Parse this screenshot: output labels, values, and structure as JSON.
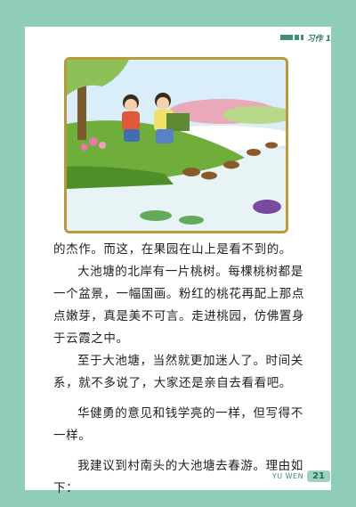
{
  "header": {
    "title": "习作 1"
  },
  "illustration": {
    "subject": "two-children-by-pond"
  },
  "text": {
    "p1": "的杰作。而这，在果园在山上是看不到的。",
    "p2": "大池塘的北岸有一片桃树。每棵桃树都是一个盆景，一幅国画。粉红的桃花再配上那点点嫩芽，真是美不可言。走进桃园，仿佛置身于云霞之中。",
    "p3": "至于大池塘，当然就更加迷人了。时间关系，就不多说了，大家还是亲自去看看吧。",
    "p4": "华健勇的意见和钱学亮的一样，但写得不一样。",
    "p5": "我建议到村南头的大池塘去春游。理由如下："
  },
  "footer": {
    "label": "YU WEN",
    "page_number": "21"
  },
  "colors": {
    "background": "#8fcdb9",
    "accent": "#3f8f78",
    "frame": "#b79a3c"
  }
}
